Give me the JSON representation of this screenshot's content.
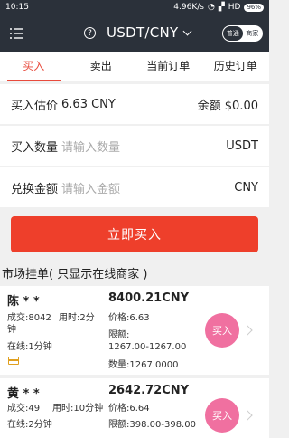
{
  "status": {
    "time": "10:15",
    "speed": "4.96K/s",
    "network": "HD",
    "battery": "96%"
  },
  "header": {
    "pair": "USDT/CNY",
    "mode_normal": "普通",
    "mode_merchant": "商家"
  },
  "tabs": [
    {
      "label": "买入"
    },
    {
      "label": "卖出"
    },
    {
      "label": "当前订单"
    },
    {
      "label": "历史订单"
    }
  ],
  "form": {
    "estimate_label": "买入估价",
    "estimate_value": "6.63 CNY",
    "balance": "余额 $0.00",
    "qty_label": "买入数量",
    "qty_placeholder": "请输入数量",
    "qty_unit": "USDT",
    "amount_label": "兑换金额",
    "amount_placeholder": "请输入金额",
    "amount_unit": "CNY",
    "submit": "立即买入"
  },
  "market": {
    "title": "市场挂单( 只显示在线商家 )",
    "listings": [
      {
        "name": "陈 * *",
        "price": "8400.21CNY",
        "deals": "成交:8042",
        "time_used": "用时:2分",
        "time_used_cont": "钟",
        "unit_price": "价格:6.63",
        "online": "在线:1分钟",
        "limit_label": "限额:",
        "limit": "1267.00-1267.00",
        "qty": "数量:1267.0000",
        "buy": "买入"
      },
      {
        "name": "黄 * *",
        "price": "2642.72CNY",
        "deals": "成交:49",
        "time_used": "用时:10分钟",
        "unit_price": "价格:6.64",
        "online": "在线:2分钟",
        "limit": "限额:398.00-398.00",
        "buy": "买入"
      }
    ]
  }
}
